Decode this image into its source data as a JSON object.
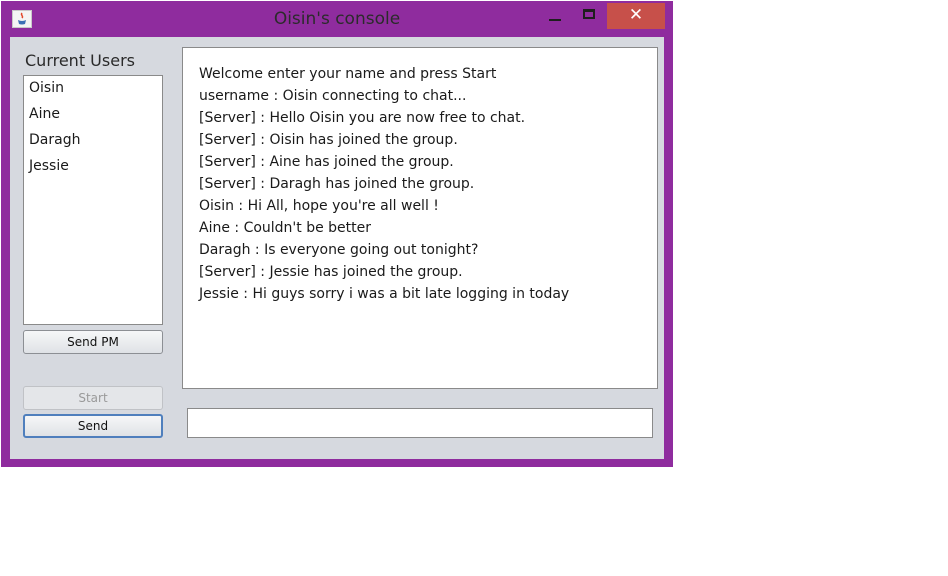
{
  "window": {
    "title": "Oisin's console",
    "close_glyph": "✕"
  },
  "users": {
    "title": "Current Users",
    "items": [
      "Oisin",
      "Aine",
      "Daragh",
      "Jessie"
    ]
  },
  "buttons": {
    "send_pm": "Send PM",
    "start": "Start",
    "send": "Send"
  },
  "chat": {
    "lines": [
      "Welcome enter your name and press Start",
      "username : Oisin connecting to chat...",
      "[Server] : Hello Oisin you are now free to chat.",
      "[Server] : Oisin has joined the group.",
      "[Server] : Aine has joined the group.",
      "[Server] : Daragh has joined the group.",
      "Oisin : Hi All, hope you're all well !",
      "Aine : Couldn't be better",
      "Daragh : Is everyone going out tonight?",
      "[Server] : Jessie has joined the group.",
      "Jessie : Hi guys sorry i was a bit late logging in today"
    ]
  },
  "input": {
    "value": ""
  },
  "colors": {
    "frame": "#8f2c9e",
    "close": "#c7504a",
    "client": "#d6d9df"
  },
  "icons": {
    "app": "java-icon",
    "minimize": "minimize-icon",
    "maximize": "maximize-icon",
    "close": "close-icon"
  }
}
